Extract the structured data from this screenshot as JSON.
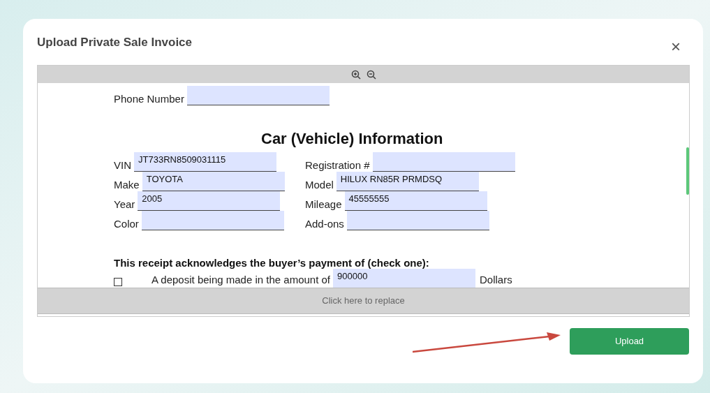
{
  "dialog": {
    "title": "Upload Private Sale Invoice",
    "close": "×"
  },
  "document": {
    "top_fields": [
      {
        "label": "Phone Number"
      }
    ],
    "heading": "Car (Vehicle) Information",
    "fields": [
      {
        "label": "VIN",
        "value": "JT733RN8509031115"
      },
      {
        "label": "Registration #"
      },
      {
        "label": "Make",
        "value": "TOYOTA"
      },
      {
        "label": "Model",
        "value": "HILUX RN85R PRMDSQ"
      },
      {
        "label": "Year",
        "value": "2005"
      },
      {
        "label": "Mileage",
        "value": "45555555"
      },
      {
        "label": "Color"
      },
      {
        "label": "Add-ons"
      }
    ],
    "payment_heading": "This receipt acknowledges the buyer’s payment of (check one):",
    "payment_options": [
      {
        "checked": false,
        "text": "A deposit being made in the amount of",
        "value": "900000",
        "suffix": "Dollars"
      }
    ]
  },
  "replace_bar": "Click here to replace",
  "upload_button": "Upload"
}
